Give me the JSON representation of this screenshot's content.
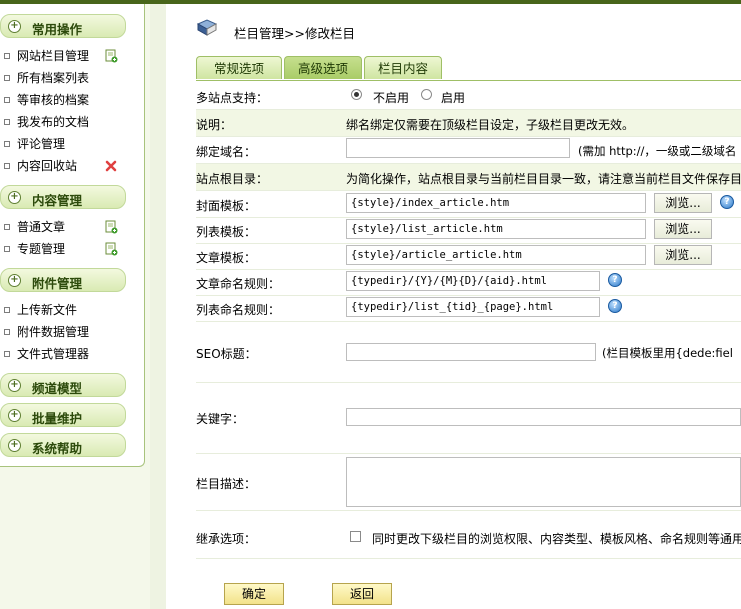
{
  "sidebar": {
    "sections": [
      {
        "title": "常用操作",
        "items": [
          {
            "label": "网站栏目管理",
            "icon": "add-page-icon"
          },
          {
            "label": "所有档案列表"
          },
          {
            "label": "等审核的档案"
          },
          {
            "label": "我发布的文档"
          },
          {
            "label": "评论管理"
          },
          {
            "label": "内容回收站",
            "icon": "delete-x-icon"
          }
        ]
      },
      {
        "title": "内容管理",
        "items": [
          {
            "label": "普通文章",
            "icon": "add-page-icon"
          },
          {
            "label": "专题管理",
            "icon": "add-page-icon"
          }
        ]
      },
      {
        "title": "附件管理",
        "items": [
          {
            "label": "上传新文件"
          },
          {
            "label": "附件数据管理"
          },
          {
            "label": "文件式管理器"
          }
        ]
      },
      {
        "title": "频道模型",
        "items": []
      },
      {
        "title": "批量维护",
        "items": []
      },
      {
        "title": "系统帮助",
        "items": []
      }
    ]
  },
  "page": {
    "title": "栏目管理>>修改栏目",
    "tabs": [
      {
        "label": "常规选项",
        "active": false
      },
      {
        "label": "高级选项",
        "active": true
      },
      {
        "label": "栏目内容",
        "active": false
      }
    ]
  },
  "form": {
    "multisite": {
      "label": "多站点支持：",
      "options": [
        {
          "label": "不启用",
          "checked": true
        },
        {
          "label": "启用",
          "checked": false
        }
      ]
    },
    "note": {
      "label": "说明：",
      "text": "绑名绑定仅需要在顶级栏目设定，子级栏目更改无效。"
    },
    "domain": {
      "label": "绑定域名：",
      "value": "",
      "hint": "(需加 http://，一级或二级域名"
    },
    "siteroot": {
      "label": "站点根目录：",
      "text": "为简化操作，站点根目录与当前栏目目录一致，请注意当前栏目文件保存目"
    },
    "cover_tpl": {
      "label": "封面模板：",
      "value": "{style}/index_article.htm",
      "browse": "浏览..."
    },
    "list_tpl": {
      "label": "列表模板：",
      "value": "{style}/list_article.htm",
      "browse": "浏览..."
    },
    "article_tpl": {
      "label": "文章模板：",
      "value": "{style}/article_article.htm",
      "browse": "浏览..."
    },
    "article_rule": {
      "label": "文章命名规则：",
      "value": "{typedir}/{Y}/{M}{D}/{aid}.html"
    },
    "list_rule": {
      "label": "列表命名规则：",
      "value": "{typedir}/list_{tid}_{page}.html"
    },
    "seo_title": {
      "label": "SEO标题：",
      "value": "",
      "hint": "(栏目模板里用{dede:fiel"
    },
    "keywords": {
      "label": "关键字：",
      "value": ""
    },
    "description": {
      "label": "栏目描述：",
      "value": ""
    },
    "inherit": {
      "label": "继承选项：",
      "checked": false,
      "text": "同时更改下级栏目的浏览权限、内容类型、模板风格、命名规则等通用"
    },
    "help_mark": "?"
  },
  "buttons": {
    "ok": "确定",
    "back": "返回"
  },
  "sidebar_plus": "+",
  "colors": {
    "accent": "#48651a",
    "tab_bg": "#cfe5a1",
    "sidebar_head": "#d9eab3"
  }
}
